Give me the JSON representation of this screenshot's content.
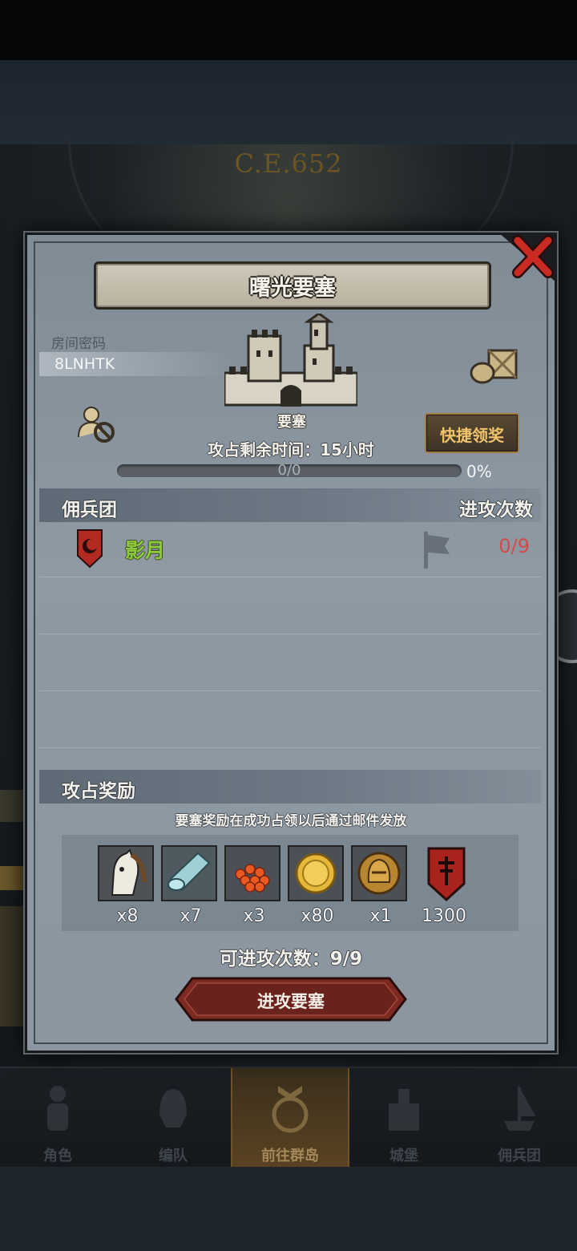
{
  "background": {
    "era_text": "C.E.652"
  },
  "modal": {
    "title": "曙光要塞",
    "room_label": "房间密码",
    "room_code": "8LNHTK",
    "building_label": "要塞",
    "quick_claim_label": "快捷领奖",
    "time_remaining": "攻占剩余时间：15小时",
    "progress": {
      "text": "0/0",
      "percent_text": "0%",
      "fraction": 0
    },
    "mercenary_section": {
      "left": "佣兵团",
      "right": "进攻次数"
    },
    "mercenaries": [
      {
        "name": "影月",
        "attacks": "0/9"
      }
    ],
    "reward_section": {
      "title": "攻占奖励"
    },
    "reward_note": "要塞奖励在成功占领以后通过邮件发放",
    "rewards": [
      {
        "icon": "horse-icon",
        "count": "x8"
      },
      {
        "icon": "cloth-roll-icon",
        "count": "x7"
      },
      {
        "icon": "red-gems-icon",
        "count": "x3"
      },
      {
        "icon": "gold-coin-icon",
        "count": "x80"
      },
      {
        "icon": "helmet-medal-icon",
        "count": "x1"
      },
      {
        "icon": "crest-banner-icon",
        "count": "1300"
      }
    ],
    "attacks_available": "可进攻次数：9/9",
    "attack_button_label": "进攻要塞"
  },
  "bottom_nav": {
    "items": [
      {
        "label": "角色",
        "active": false
      },
      {
        "label": "编队",
        "active": false
      },
      {
        "label": "前往群岛",
        "active": true
      },
      {
        "label": "城堡",
        "active": false
      },
      {
        "label": "佣兵团",
        "active": false
      }
    ]
  },
  "colors": {
    "accent_gold": "#c9a24a",
    "mercenary_green": "#8ecb3d",
    "attack_count_red": "#d44a4a",
    "close_red": "#c92a22"
  }
}
